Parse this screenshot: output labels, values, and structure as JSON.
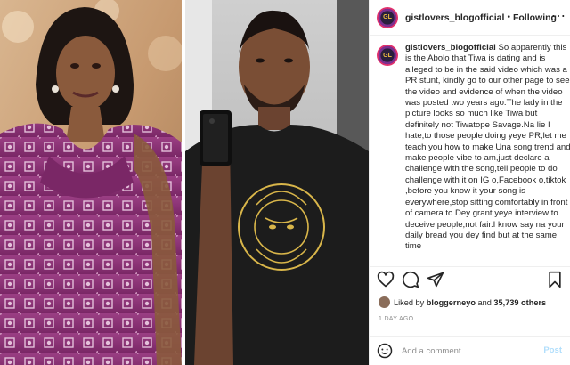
{
  "post": {
    "username": "gistlovers_blogofficial",
    "follow_status": "Following",
    "avatar_text": "GL",
    "caption_text": "So apparently this is the Abolo that Tiwa is dating and is alleged to be in the said video which was a PR stunt, kindly go to our other page to see the video and evidence of when the video was posted two years ago.The lady in the picture looks so much like Tiwa but definitely not Tiwatope Savage.Na lie I hate,to those people doing yeye PR,let me teach you how to make Una song trend and make people vibe to am,just declare a challenge with the song,tell people to do challenge with it on IG o,Facebook o,tiktok ,before you know it your song is everywhere,stop sitting comfortably in front of camera to Dey grant yeye interview to deceive people,not fair.I know say na your daily bread you dey find but at the same time",
    "likes": {
      "prefix": "Liked by",
      "user": "bloggerneyo",
      "connector": "and",
      "count": "35,739 others"
    },
    "time_ago": "1 DAY AGO",
    "comment": {
      "placeholder": "Add a comment…",
      "post_label": "Post"
    }
  },
  "colors": {
    "link_disabled": "#b2dffc",
    "muted": "#8e8e8e",
    "text": "#262626",
    "border": "#efefef"
  },
  "icons": [
    "more-icon",
    "heart-icon",
    "comment-icon",
    "share-icon",
    "bookmark-icon",
    "emoji-icon"
  ]
}
